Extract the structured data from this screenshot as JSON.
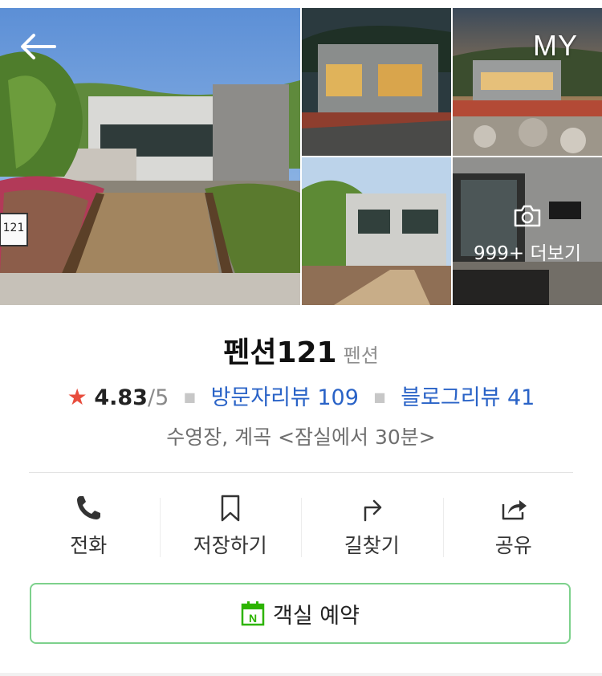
{
  "header": {
    "back_icon": "arrow-left-icon",
    "my_label": "MY"
  },
  "gallery": {
    "photos": [
      "main-pension-exterior",
      "night-exterior",
      "dusk-exterior-rocks",
      "exterior-bridge",
      "interior-room"
    ],
    "more_label": "999+ 더보기",
    "more_icon": "camera-icon"
  },
  "place": {
    "name": "펜션121",
    "category": "펜션",
    "rating": "4.83",
    "rating_max": "/5",
    "visitor_reviews_label": "방문자리뷰 109",
    "blog_reviews_label": "블로그리뷰 41",
    "description": "수영장, 계곡 <잠실에서 30분>"
  },
  "actions": [
    {
      "label": "전화",
      "icon": "phone-icon"
    },
    {
      "label": "저장하기",
      "icon": "bookmark-icon"
    },
    {
      "label": "길찾기",
      "icon": "directions-icon"
    },
    {
      "label": "공유",
      "icon": "share-icon"
    }
  ],
  "reserve": {
    "label": "객실 예약",
    "icon": "naver-calendar-icon"
  },
  "colors": {
    "star": "#e84d3d",
    "link": "#2a63c7",
    "reserve_border": "#7dd18c",
    "naver_green": "#2db400"
  }
}
